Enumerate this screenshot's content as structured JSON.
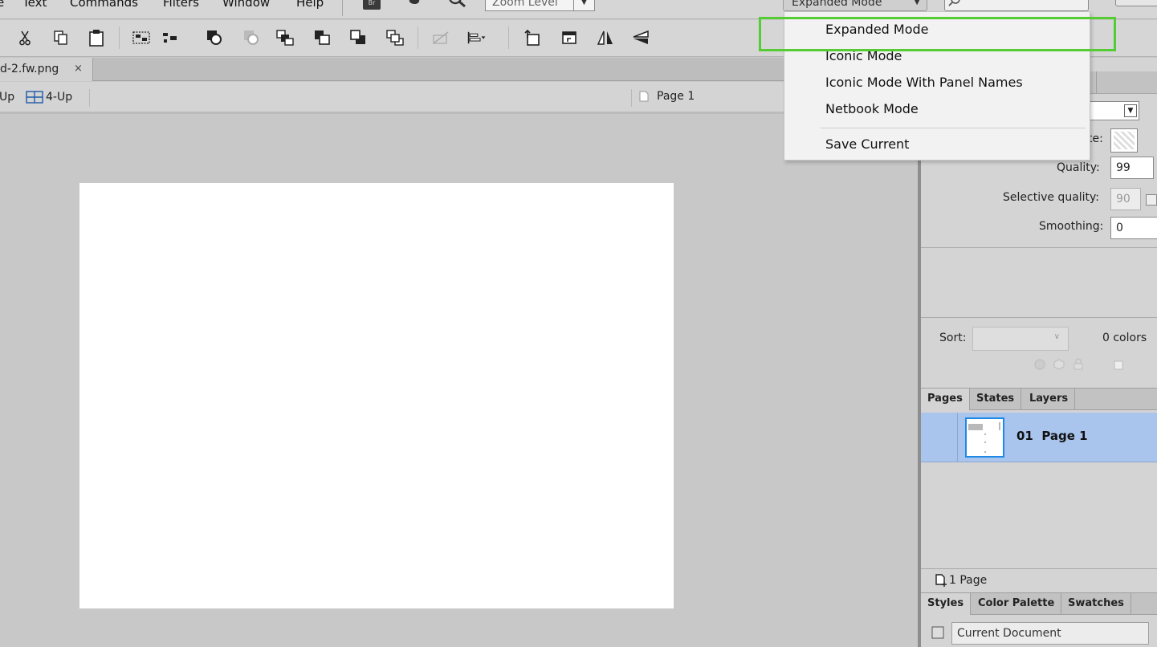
{
  "menubar": {
    "items": [
      "e",
      "Text",
      "Commands",
      "Filters",
      "Window",
      "Help"
    ],
    "bridge_icon": "br-icon",
    "zoom_placeholder": "Zoom Level",
    "workspace_mode": "Expanded Mode"
  },
  "doc_tab": {
    "title": "d-2.fw.png",
    "close": "×"
  },
  "viewbar": {
    "two_up": "Up",
    "four_up": "4-Up",
    "page": "Page 1"
  },
  "workspace_menu": {
    "items": [
      "Expanded Mode",
      "Iconic Mode",
      "Iconic Mode With Panel Names",
      "Netbook Mode"
    ],
    "save": "Save Current",
    "highlighted": "Expanded Mode",
    "highlight_color": "#55cc33"
  },
  "properties": {
    "partial_label": "te:",
    "quality_label": "Quality:",
    "quality_value": "99",
    "selective_label": "Selective quality:",
    "selective_value": "90",
    "smoothing_label": "Smoothing:",
    "smoothing_value": "0"
  },
  "palette": {
    "sort_label": "Sort:",
    "count": "0 colors"
  },
  "pages_panel": {
    "tabs": [
      "Pages",
      "States",
      "Layers"
    ],
    "page_number": "01",
    "page_name": "Page 1",
    "footer": "1 Page",
    "selected_color": "#a9c5ee"
  },
  "styles_panel": {
    "tabs": [
      "Styles",
      "Color Palette",
      "Swatches"
    ],
    "current": "Current Document"
  }
}
